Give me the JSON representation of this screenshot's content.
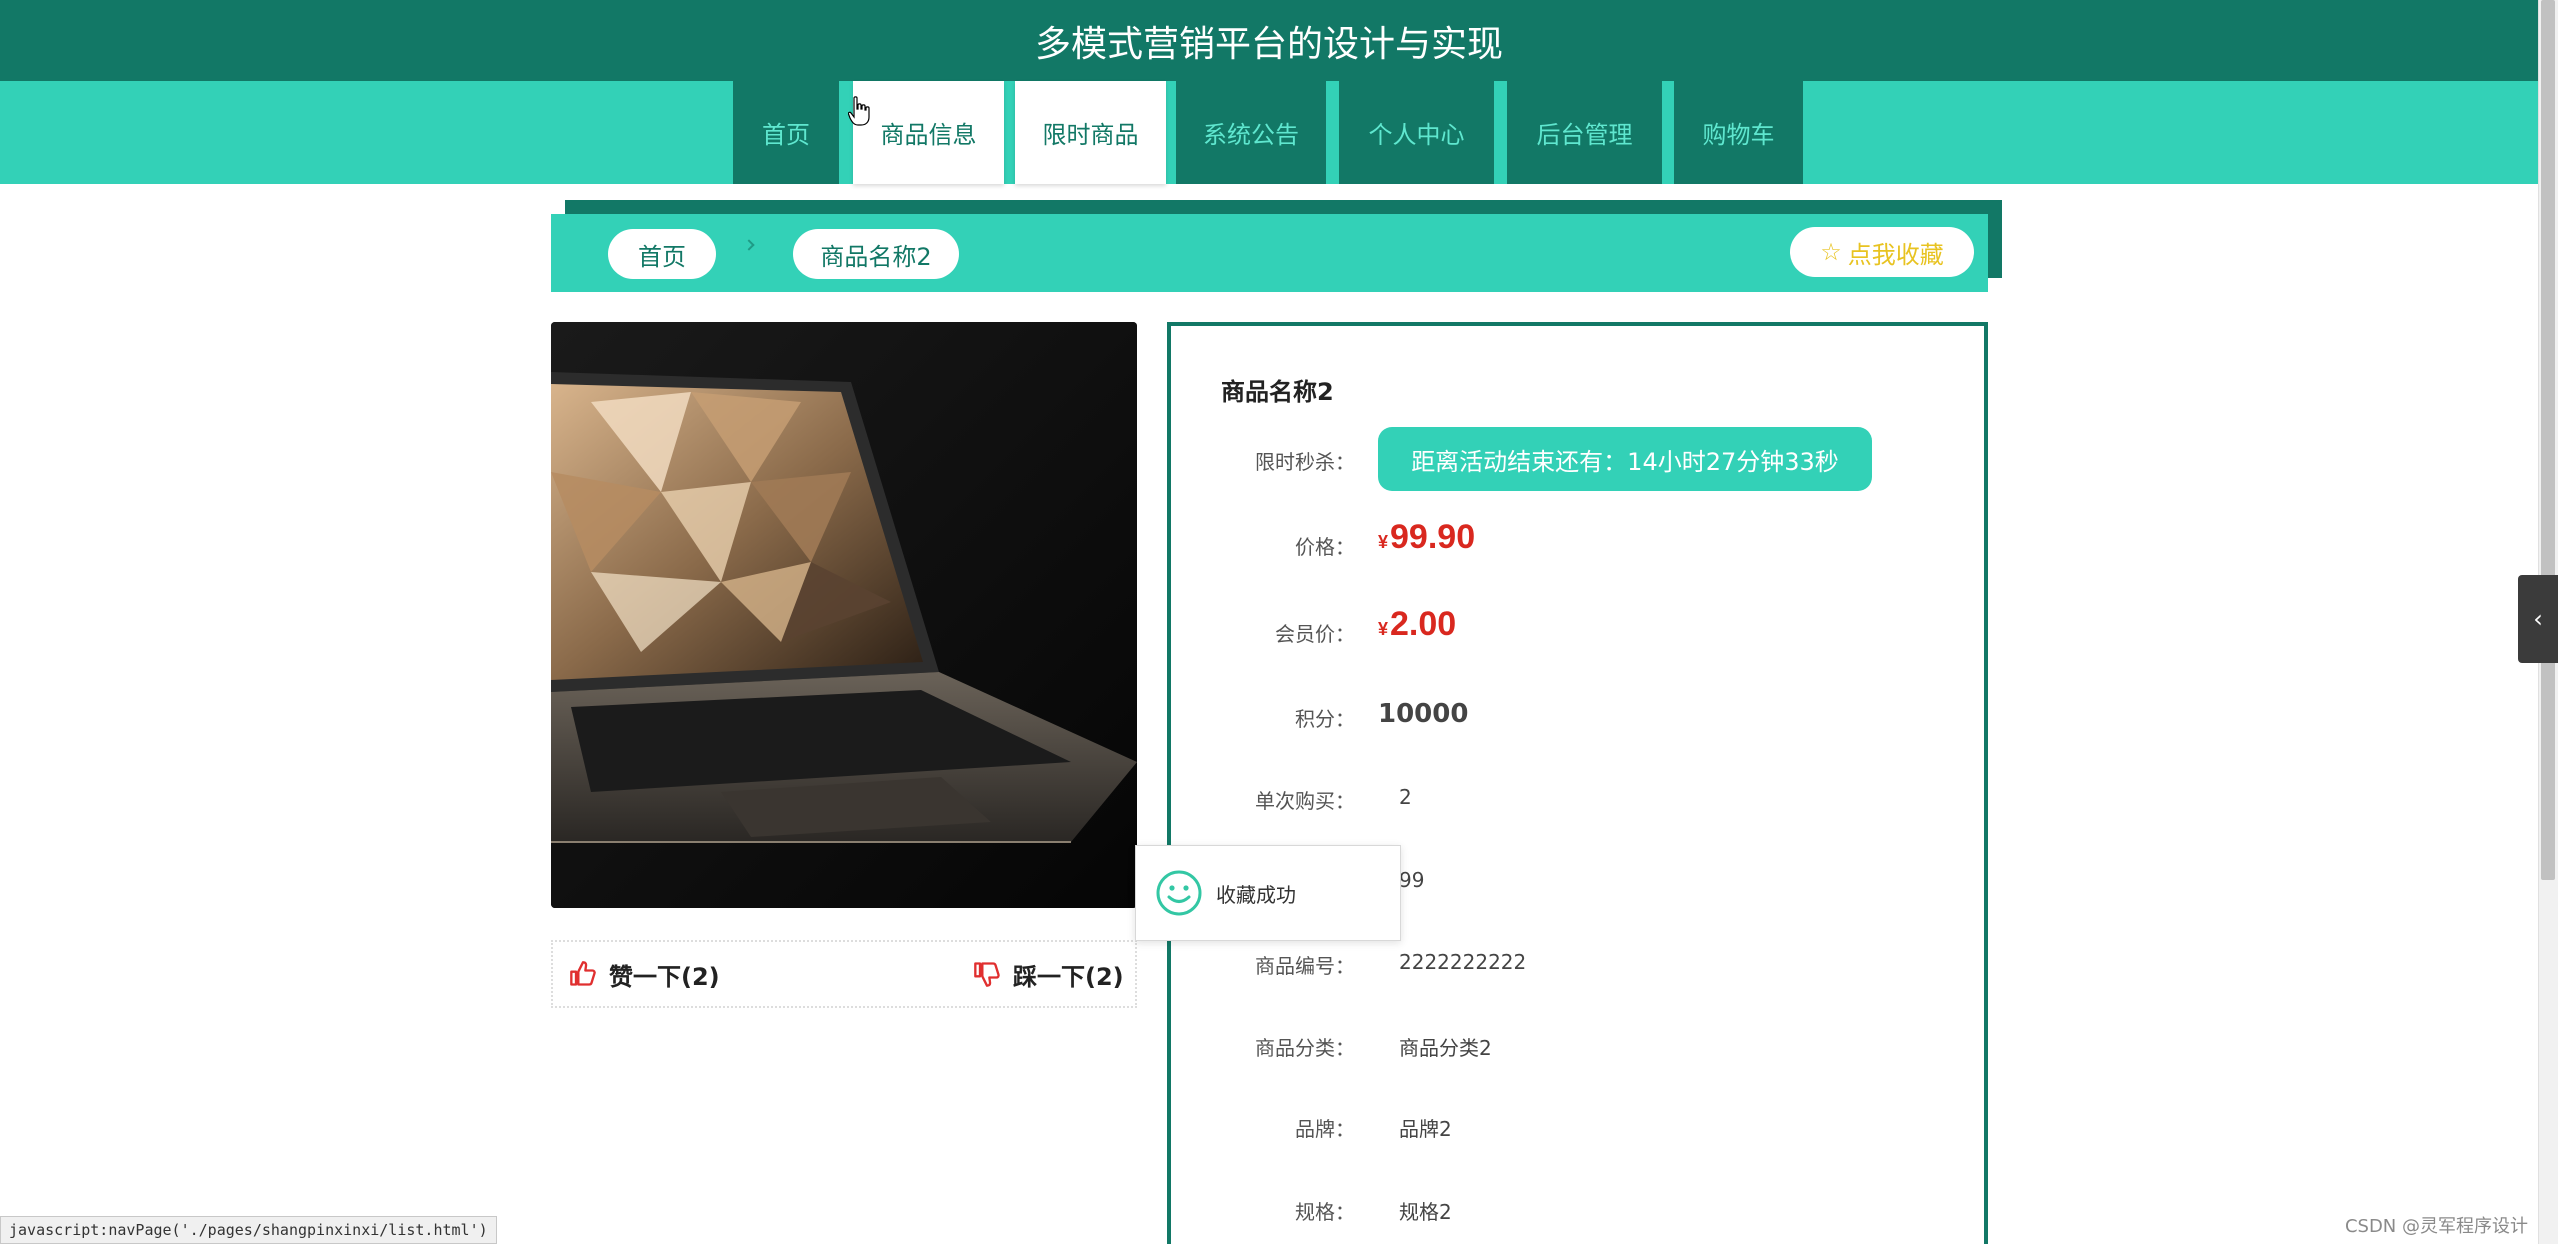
{
  "site": {
    "title": "多模式营销平台的设计与实现"
  },
  "nav": {
    "items": [
      {
        "label": "首页"
      },
      {
        "label": "商品信息"
      },
      {
        "label": "限时商品"
      },
      {
        "label": "系统公告"
      },
      {
        "label": "个人中心"
      },
      {
        "label": "后台管理"
      },
      {
        "label": "购物车"
      }
    ],
    "active": "商品信息"
  },
  "breadcrumb": {
    "home": "首页",
    "current": "商品名称2",
    "favorite_button": "点我收藏"
  },
  "product": {
    "name": "商品名称2",
    "image_icon": "laptop-photo",
    "rows": {
      "flash_sale_label": "限时秒杀：",
      "countdown_text": "距离活动结束还有：14小时27分钟33秒",
      "price_label": "价格：",
      "currency": "¥",
      "price": "99.90",
      "member_price_label": "会员价：",
      "member_price": "2.00",
      "points_label": "积分：",
      "points": "10000",
      "single_purchase_label": "单次购买：",
      "single_purchase": "2",
      "stock_value": "99",
      "code_label": "商品编号：",
      "code": "2222222222",
      "category_label": "商品分类：",
      "category": "商品分类2",
      "brand_label": "品牌：",
      "brand": "品牌2",
      "spec_label": "规格：",
      "spec": "规格2"
    }
  },
  "votes": {
    "like": "赞一下(2)",
    "dislike": "踩一下(2)"
  },
  "toast": {
    "message": "收藏成功"
  },
  "status_bar": {
    "url": "javascript:navPage('./pages/shangpinxinxi/list.html')"
  },
  "watermark": "CSDN @灵军程序设计",
  "colors": {
    "dark_teal": "#127866",
    "light_teal": "#33d1b7",
    "price_red": "#d9281f",
    "favorite_gold": "#e8c321"
  }
}
